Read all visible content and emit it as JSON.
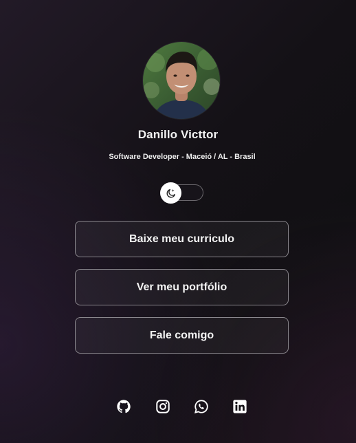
{
  "profile": {
    "name": "Danillo Victtor",
    "subtitle": "Software Developer - Maceió / AL - Brasil",
    "avatar_icon": "avatar-photo"
  },
  "theme_toggle": {
    "icon": "moon-icon",
    "state": "dark"
  },
  "buttons": [
    {
      "label": "Baixe meu curriculo"
    },
    {
      "label": "Ver meu portfólio"
    },
    {
      "label": "Fale comigo"
    }
  ],
  "social": [
    {
      "icon": "github-icon"
    },
    {
      "icon": "instagram-icon"
    },
    {
      "icon": "whatsapp-icon"
    },
    {
      "icon": "linkedin-icon"
    }
  ],
  "colors": {
    "background": "#141116",
    "text": "#f2f2f2",
    "button_border": "#8b888e",
    "knob": "#ffffff"
  }
}
